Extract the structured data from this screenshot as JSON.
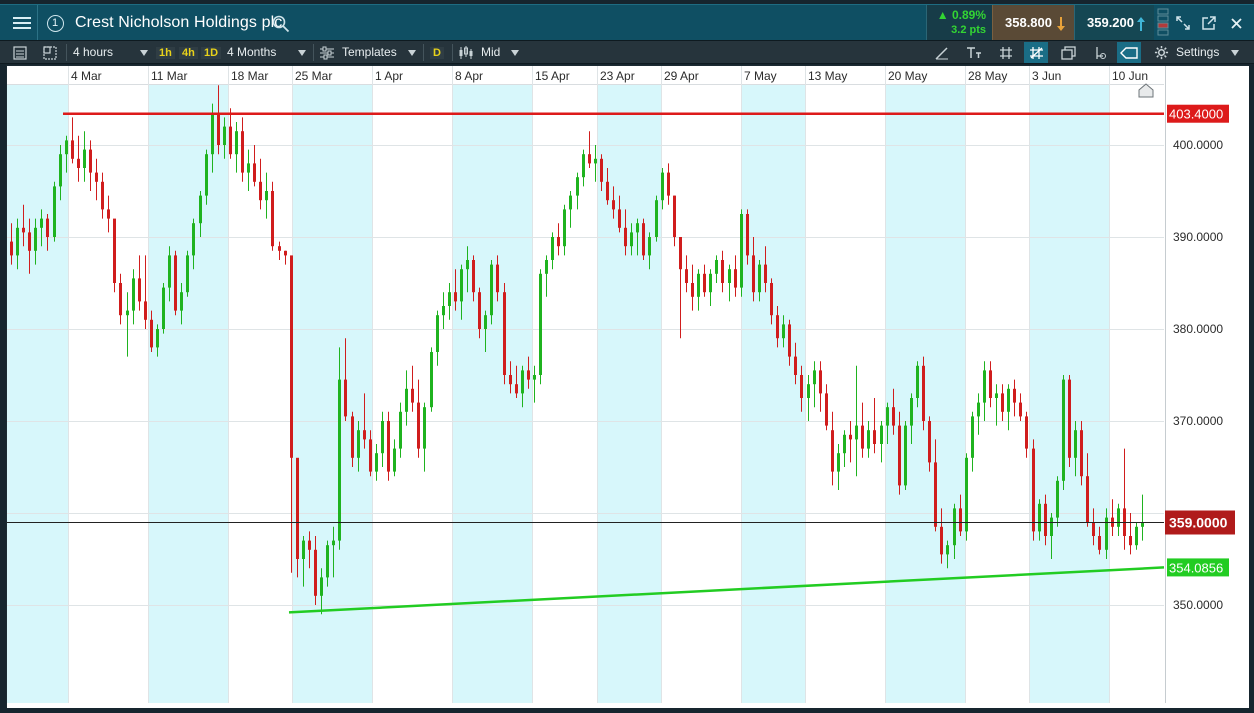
{
  "header": {
    "title": "Crest Nicholson Holdings plc",
    "change_pct": "▲ 0.89%",
    "change_pts": "3.2 pts",
    "sell_price": "358.800",
    "buy_price": "359.200",
    "colors": {
      "up": "#33d533",
      "sell_arrow": "#e8a23a",
      "buy_arrow": "#3fb6d8"
    }
  },
  "toolbar": {
    "interval": "4 hours",
    "quick_1h": "1h",
    "quick_4h": "4h",
    "quick_1d": "1D",
    "range": "4 Months",
    "templates": "Templates",
    "d_badge": "D",
    "price_type": "Mid",
    "settings": "Settings"
  },
  "chart_data": {
    "type": "candlestick",
    "title": "",
    "x_tick_labels": [
      "4 Mar",
      "11 Mar",
      "18 Mar",
      "25 Mar",
      "1 Apr",
      "8 Apr",
      "15 Apr",
      "23 Apr",
      "29 Apr",
      "7 May",
      "13 May",
      "20 May",
      "28 May",
      "3 Jun",
      "10 Jun"
    ],
    "y_tick_labels": [
      "400.0000",
      "390.0000",
      "380.0000",
      "370.0000",
      "350.0000"
    ],
    "y_ticks": [
      400,
      390,
      380,
      370,
      350
    ],
    "ylim": [
      340.5,
      407.5
    ],
    "grid": true,
    "colors": {
      "up": "#1fb31f",
      "down": "#d01d1d",
      "resistance": "#dd1a1a",
      "support": "#22cc22",
      "current": "#222222",
      "week_shade": "#d7f7fb"
    },
    "resistance_level": 403.4,
    "resistance_label": "403.4000",
    "support_line": {
      "start": {
        "date": "25 Mar",
        "value": 349.2
      },
      "end": {
        "date": "11 Jun",
        "value": 354.0856
      }
    },
    "support_label": "354.0856",
    "current_price": 359.0,
    "current_label": "359.0000",
    "candles": [
      [
        389.5,
        391.5,
        387.0,
        388.0
      ],
      [
        388.0,
        392.0,
        386.5,
        391.0
      ],
      [
        391.0,
        393.5,
        389.0,
        390.5
      ],
      [
        390.5,
        392.0,
        386.0,
        388.5
      ],
      [
        388.5,
        392.0,
        387.0,
        391.0
      ],
      [
        391.0,
        393.0,
        389.0,
        392.0
      ],
      [
        392.0,
        392.5,
        388.5,
        390.0
      ],
      [
        390.0,
        396.0,
        389.5,
        395.5
      ],
      [
        395.5,
        400.0,
        394.0,
        399.0
      ],
      [
        399.0,
        401.0,
        397.0,
        400.5
      ],
      [
        400.5,
        403.0,
        398.0,
        398.5
      ],
      [
        398.5,
        401.0,
        396.0,
        397.5
      ],
      [
        397.5,
        401.5,
        396.0,
        399.5
      ],
      [
        399.5,
        400.5,
        395.0,
        397.0
      ],
      [
        397.0,
        398.5,
        394.0,
        396.0
      ],
      [
        396.0,
        397.0,
        392.0,
        393.0
      ],
      [
        393.0,
        394.5,
        390.5,
        392.0
      ],
      [
        392.0,
        390.0,
        384.0,
        385.0
      ],
      [
        385.0,
        386.0,
        380.5,
        381.5
      ],
      [
        381.5,
        384.0,
        377.0,
        382.0
      ],
      [
        382.0,
        386.5,
        380.5,
        385.5
      ],
      [
        385.5,
        388.0,
        382.0,
        383.0
      ],
      [
        383.0,
        388.0,
        380.0,
        381.0
      ],
      [
        381.0,
        382.0,
        377.5,
        378.0
      ],
      [
        378.0,
        380.5,
        377.0,
        380.0
      ],
      [
        380.0,
        385.0,
        379.5,
        384.5
      ],
      [
        384.5,
        389.0,
        383.0,
        388.0
      ],
      [
        388.0,
        388.5,
        381.5,
        382.0
      ],
      [
        382.0,
        385.0,
        380.5,
        384.0
      ],
      [
        384.0,
        388.5,
        383.5,
        388.0
      ],
      [
        388.0,
        392.0,
        386.5,
        391.5
      ],
      [
        391.5,
        395.0,
        390.0,
        394.5
      ],
      [
        394.5,
        399.5,
        393.5,
        399.0
      ],
      [
        399.0,
        404.5,
        397.0,
        403.5
      ],
      [
        403.5,
        406.5,
        399.0,
        400.0
      ],
      [
        400.0,
        403.0,
        398.5,
        402.0
      ],
      [
        402.0,
        404.0,
        398.5,
        399.0
      ],
      [
        399.0,
        402.5,
        397.0,
        401.5
      ],
      [
        401.5,
        403.0,
        396.0,
        397.0
      ],
      [
        397.0,
        399.5,
        395.0,
        398.0
      ],
      [
        398.0,
        400.0,
        395.5,
        396.0
      ],
      [
        396.0,
        398.5,
        393.0,
        394.0
      ],
      [
        394.0,
        397.0,
        392.0,
        395.0
      ],
      [
        395.0,
        396.0,
        388.5,
        389.0
      ],
      [
        389.0,
        389.5,
        387.5,
        388.5
      ],
      [
        388.5,
        388.5,
        387.0,
        388.0
      ],
      [
        388.0,
        372.0,
        353.5,
        366.0
      ],
      [
        366.0,
        365.0,
        353.0,
        355.0
      ],
      [
        355.0,
        357.5,
        352.0,
        357.0
      ],
      [
        357.0,
        358.0,
        354.0,
        356.0
      ],
      [
        356.0,
        357.5,
        350.0,
        351.0
      ],
      [
        351.0,
        354.0,
        349.0,
        353.0
      ],
      [
        353.0,
        357.0,
        352.0,
        356.5
      ],
      [
        356.5,
        358.5,
        353.0,
        357.0
      ],
      [
        357.0,
        378.0,
        356.0,
        374.5
      ],
      [
        374.5,
        379.0,
        370.0,
        370.5
      ],
      [
        370.5,
        371.0,
        365.0,
        366.0
      ],
      [
        366.0,
        370.0,
        364.5,
        369.0
      ],
      [
        369.0,
        373.0,
        367.0,
        368.0
      ],
      [
        368.0,
        369.0,
        364.0,
        364.5
      ],
      [
        364.5,
        367.5,
        363.5,
        366.5
      ],
      [
        366.5,
        371.0,
        365.0,
        370.0
      ],
      [
        370.0,
        371.0,
        363.5,
        364.5
      ],
      [
        364.5,
        368.0,
        364.0,
        367.0
      ],
      [
        367.0,
        372.0,
        366.0,
        371.0
      ],
      [
        371.0,
        375.5,
        369.5,
        373.5
      ],
      [
        373.5,
        376.0,
        371.0,
        372.0
      ],
      [
        372.0,
        374.5,
        366.0,
        367.0
      ],
      [
        367.0,
        372.0,
        364.5,
        371.5
      ],
      [
        371.5,
        378.0,
        371.0,
        377.5
      ],
      [
        377.5,
        382.0,
        376.0,
        381.5
      ],
      [
        381.5,
        384.0,
        380.0,
        382.5
      ],
      [
        382.5,
        385.0,
        381.0,
        384.0
      ],
      [
        384.0,
        386.5,
        382.0,
        383.0
      ],
      [
        383.0,
        387.0,
        381.0,
        386.5
      ],
      [
        386.5,
        389.0,
        384.0,
        387.5
      ],
      [
        387.5,
        388.0,
        383.0,
        384.0
      ],
      [
        384.0,
        384.5,
        379.0,
        380.0
      ],
      [
        380.0,
        382.0,
        377.5,
        381.5
      ],
      [
        381.5,
        387.5,
        380.5,
        387.0
      ],
      [
        387.0,
        388.0,
        383.0,
        384.0
      ],
      [
        384.0,
        385.0,
        374.0,
        375.0
      ],
      [
        375.0,
        376.5,
        373.0,
        374.0
      ],
      [
        374.0,
        376.0,
        372.5,
        373.0
      ],
      [
        373.0,
        376.0,
        371.5,
        375.5
      ],
      [
        375.5,
        377.0,
        373.5,
        374.5
      ],
      [
        374.5,
        376.0,
        372.0,
        375.0
      ],
      [
        375.0,
        386.5,
        374.0,
        386.0
      ],
      [
        386.0,
        388.0,
        383.5,
        387.5
      ],
      [
        387.5,
        390.5,
        386.5,
        390.0
      ],
      [
        390.0,
        391.5,
        388.0,
        389.0
      ],
      [
        389.0,
        393.5,
        388.0,
        393.0
      ],
      [
        393.0,
        395.0,
        391.0,
        394.5
      ],
      [
        394.5,
        397.0,
        393.0,
        396.5
      ],
      [
        396.5,
        399.5,
        395.5,
        399.0
      ],
      [
        399.0,
        401.5,
        397.5,
        398.0
      ],
      [
        398.0,
        400.0,
        396.0,
        398.5
      ],
      [
        398.5,
        399.0,
        395.0,
        396.0
      ],
      [
        396.0,
        397.5,
        393.5,
        394.0
      ],
      [
        394.0,
        395.5,
        392.0,
        393.0
      ],
      [
        393.0,
        394.5,
        390.5,
        391.0
      ],
      [
        391.0,
        393.0,
        388.0,
        389.0
      ],
      [
        389.0,
        391.5,
        388.0,
        390.5
      ],
      [
        390.5,
        392.0,
        388.0,
        391.5
      ],
      [
        391.5,
        392.0,
        387.5,
        388.0
      ],
      [
        388.0,
        390.5,
        386.5,
        390.0
      ],
      [
        390.0,
        394.5,
        389.5,
        394.0
      ],
      [
        394.0,
        397.5,
        393.0,
        397.0
      ],
      [
        397.0,
        398.0,
        393.5,
        394.5
      ],
      [
        394.5,
        394.5,
        389.0,
        390.0
      ],
      [
        390.0,
        390.0,
        379.0,
        386.5
      ],
      [
        386.5,
        388.0,
        384.0,
        385.0
      ],
      [
        385.0,
        387.0,
        382.0,
        383.5
      ],
      [
        383.5,
        386.5,
        382.0,
        386.0
      ],
      [
        386.0,
        387.0,
        383.5,
        384.0
      ],
      [
        384.0,
        386.5,
        382.5,
        386.0
      ],
      [
        386.0,
        388.0,
        385.0,
        387.5
      ],
      [
        387.5,
        388.5,
        384.0,
        385.0
      ],
      [
        385.0,
        387.0,
        383.0,
        386.5
      ],
      [
        386.5,
        388.0,
        383.5,
        384.5
      ],
      [
        384.5,
        393.0,
        383.5,
        392.5
      ],
      [
        392.5,
        393.0,
        387.0,
        388.0
      ],
      [
        388.0,
        390.0,
        383.0,
        384.0
      ],
      [
        384.0,
        387.5,
        383.0,
        387.0
      ],
      [
        387.0,
        389.0,
        384.0,
        385.0
      ],
      [
        385.0,
        385.5,
        380.5,
        381.5
      ],
      [
        381.5,
        382.5,
        378.0,
        379.0
      ],
      [
        379.0,
        381.5,
        378.0,
        380.5
      ],
      [
        380.5,
        381.0,
        376.0,
        377.0
      ],
      [
        377.0,
        378.5,
        374.0,
        375.0
      ],
      [
        375.0,
        376.0,
        371.0,
        372.5
      ],
      [
        372.5,
        375.0,
        370.0,
        374.0
      ],
      [
        374.0,
        376.5,
        371.5,
        375.5
      ],
      [
        375.5,
        376.5,
        371.0,
        373.0
      ],
      [
        373.0,
        374.0,
        369.0,
        369.5
      ],
      [
        369.0,
        371.0,
        363.0,
        364.5
      ],
      [
        364.5,
        367.5,
        362.5,
        366.5
      ],
      [
        366.5,
        369.0,
        365.0,
        368.5
      ],
      [
        368.5,
        370.0,
        365.5,
        368.0
      ],
      [
        368.0,
        376.0,
        364.0,
        369.5
      ],
      [
        369.5,
        372.0,
        366.0,
        367.0
      ],
      [
        367.0,
        370.0,
        366.0,
        369.0
      ],
      [
        369.0,
        372.5,
        366.5,
        367.5
      ],
      [
        367.5,
        370.0,
        365.5,
        369.5
      ],
      [
        369.5,
        372.0,
        367.5,
        371.5
      ],
      [
        371.5,
        373.5,
        368.5,
        369.5
      ],
      [
        369.5,
        371.0,
        362.0,
        363.0
      ],
      [
        363.0,
        370.0,
        362.5,
        369.5
      ],
      [
        369.5,
        373.0,
        367.5,
        372.5
      ],
      [
        372.5,
        376.5,
        371.5,
        376.0
      ],
      [
        376.0,
        377.0,
        369.0,
        370.0
      ],
      [
        370.0,
        370.5,
        364.5,
        365.5
      ],
      [
        365.5,
        368.0,
        358.0,
        358.5
      ],
      [
        358.5,
        360.5,
        354.5,
        355.5
      ],
      [
        355.5,
        357.0,
        354.0,
        356.5
      ],
      [
        356.5,
        361.0,
        355.0,
        360.5
      ],
      [
        360.5,
        362.0,
        357.5,
        358.0
      ],
      [
        358.0,
        366.5,
        357.0,
        366.0
      ],
      [
        366.0,
        371.0,
        364.5,
        370.5
      ],
      [
        370.5,
        373.0,
        368.5,
        372.0
      ],
      [
        372.0,
        376.5,
        370.0,
        375.5
      ],
      [
        375.5,
        376.5,
        371.5,
        372.5
      ],
      [
        372.5,
        374.0,
        369.5,
        373.0
      ],
      [
        373.0,
        374.0,
        370.0,
        371.0
      ],
      [
        371.0,
        374.0,
        369.0,
        373.5
      ],
      [
        373.5,
        374.5,
        370.5,
        372.0
      ],
      [
        372.0,
        373.0,
        370.0,
        370.5
      ],
      [
        370.5,
        371.0,
        366.0,
        367.0
      ],
      [
        367.0,
        368.0,
        357.0,
        358.0
      ],
      [
        358.0,
        361.5,
        357.0,
        361.0
      ],
      [
        361.0,
        362.0,
        356.5,
        357.5
      ],
      [
        357.5,
        360.0,
        355.0,
        359.5
      ],
      [
        359.5,
        364.0,
        358.5,
        363.5
      ],
      [
        363.5,
        375.0,
        362.5,
        374.5
      ],
      [
        374.5,
        375.0,
        365.0,
        366.0
      ],
      [
        366.0,
        370.0,
        364.0,
        369.0
      ],
      [
        369.0,
        370.0,
        363.0,
        364.0
      ],
      [
        364.0,
        366.5,
        358.5,
        359.0
      ],
      [
        359.0,
        360.5,
        356.5,
        357.5
      ],
      [
        357.5,
        358.5,
        355.5,
        356.0
      ],
      [
        356.0,
        360.5,
        355.0,
        359.5
      ],
      [
        359.5,
        361.5,
        357.5,
        358.5
      ],
      [
        358.5,
        361.0,
        357.5,
        360.5
      ],
      [
        360.5,
        367.0,
        356.0,
        357.5
      ],
      [
        357.5,
        360.0,
        355.5,
        356.5
      ],
      [
        356.5,
        359.0,
        356.0,
        358.5
      ],
      [
        358.5,
        362.0,
        357.0,
        359.0
      ]
    ]
  }
}
